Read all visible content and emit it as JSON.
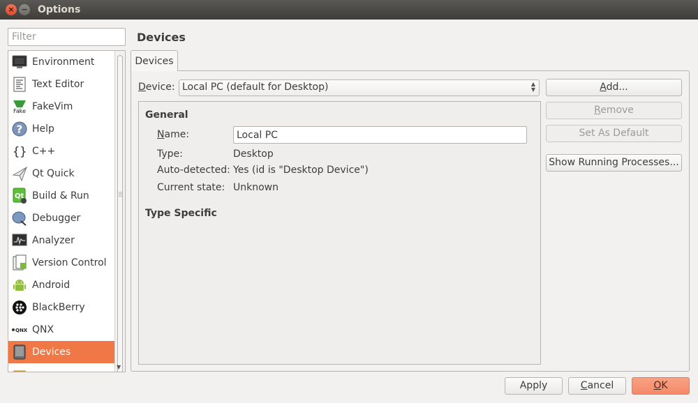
{
  "window": {
    "title": "Options"
  },
  "filter": {
    "placeholder": "Filter"
  },
  "categories": [
    {
      "label": "Environment",
      "icon": "monitor-icon"
    },
    {
      "label": "Text Editor",
      "icon": "text-document-icon"
    },
    {
      "label": "FakeVim",
      "icon": "fakevim-icon"
    },
    {
      "label": "Help",
      "icon": "question-mark-icon"
    },
    {
      "label": "C++",
      "icon": "braces-icon"
    },
    {
      "label": "Qt Quick",
      "icon": "paper-plane-icon"
    },
    {
      "label": "Build & Run",
      "icon": "qt-build-icon"
    },
    {
      "label": "Debugger",
      "icon": "bug-icon"
    },
    {
      "label": "Analyzer",
      "icon": "oscilloscope-icon"
    },
    {
      "label": "Version Control",
      "icon": "version-control-icon"
    },
    {
      "label": "Android",
      "icon": "android-icon"
    },
    {
      "label": "BlackBerry",
      "icon": "blackberry-icon"
    },
    {
      "label": "QNX",
      "icon": "qnx-icon"
    },
    {
      "label": "Devices",
      "icon": "device-icon",
      "selected": true
    }
  ],
  "page": {
    "title": "Devices"
  },
  "tabs": [
    {
      "label": "Devices"
    }
  ],
  "device_selector": {
    "label_prefix": "D",
    "label_rest": "evice:",
    "value": "Local PC (default for Desktop)"
  },
  "general": {
    "heading": "General",
    "name_label_prefix": "N",
    "name_label_rest": "ame:",
    "name_value": "Local PC",
    "type_label": "Type:",
    "type_value": "Desktop",
    "auto_label": "Auto-detected:",
    "auto_value": "Yes (id is \"Desktop Device\")",
    "state_label": "Current state:",
    "state_value": "Unknown"
  },
  "type_specific": {
    "heading": "Type Specific"
  },
  "side_buttons": {
    "add_prefix": "A",
    "add_rest": "dd...",
    "remove_prefix": "R",
    "remove_rest": "emove",
    "set_default": "Set As Default",
    "show_processes": "Show Running Processes..."
  },
  "footer": {
    "apply": "Apply",
    "cancel_prefix": "C",
    "cancel_rest": "ancel",
    "ok_prefix": "O",
    "ok_rest": "K"
  },
  "colors": {
    "accent": "#f07746",
    "ok_button": "#f58a69",
    "titlebar": "#3e3d39"
  }
}
